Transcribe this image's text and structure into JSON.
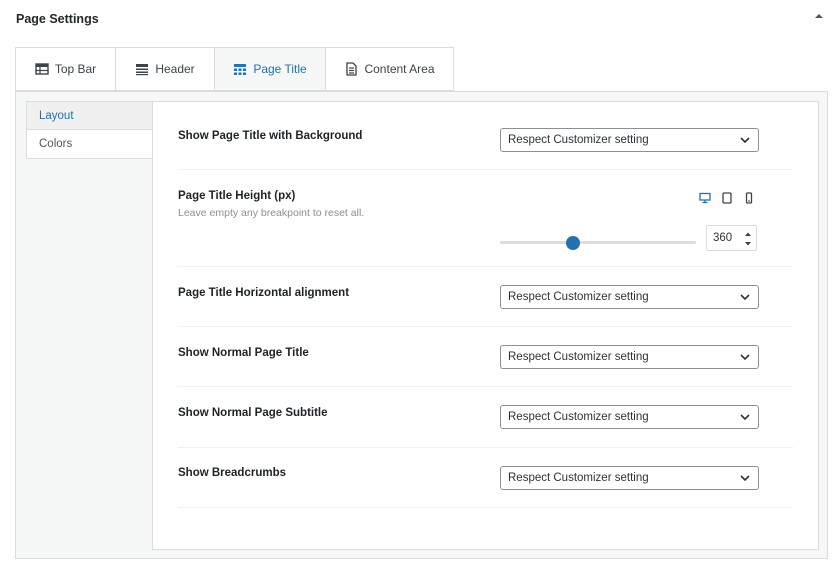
{
  "panel": {
    "title": "Page Settings"
  },
  "tabs": [
    {
      "label": "Top Bar",
      "icon": "table-icon",
      "active": false
    },
    {
      "label": "Header",
      "icon": "header-icon",
      "active": false
    },
    {
      "label": "Page Title",
      "icon": "grid-icon",
      "active": true
    },
    {
      "label": "Content Area",
      "icon": "document-icon",
      "active": false
    }
  ],
  "side_nav": [
    {
      "label": "Layout",
      "active": true
    },
    {
      "label": "Colors",
      "active": false
    }
  ],
  "fields": {
    "bg": {
      "label": "Show Page Title with Background",
      "value": "Respect Customizer setting"
    },
    "height": {
      "label": "Page Title Height (px)",
      "description": "Leave empty any breakpoint to reset all.",
      "value": "360",
      "slider_fraction": 0.36,
      "breakpoints": [
        "desktop-icon",
        "tablet-icon",
        "mobile-icon"
      ]
    },
    "align": {
      "label": "Page Title Horizontal alignment",
      "value": "Respect Customizer setting"
    },
    "normal_title": {
      "label": "Show Normal Page Title",
      "value": "Respect Customizer setting"
    },
    "normal_subtitle": {
      "label": "Show Normal Page Subtitle",
      "value": "Respect Customizer setting"
    },
    "breadcrumbs": {
      "label": "Show Breadcrumbs",
      "value": "Respect Customizer setting"
    }
  },
  "colors": {
    "accent": "#2271b1",
    "border": "#dcdcde",
    "muted_text": "#8c8f94"
  }
}
